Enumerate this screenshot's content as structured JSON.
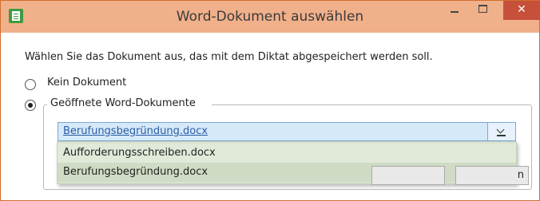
{
  "window": {
    "title": "Word-Dokument auswählen",
    "icon": "word-document-icon",
    "controls": {
      "minimize": "minimize-icon",
      "maximize": "maximize-icon",
      "close": "close-icon"
    },
    "colors": {
      "titlebar": "#f0b08a",
      "close_button": "#c7503a",
      "border": "#d06f2e"
    }
  },
  "content": {
    "instruction": "Wählen Sie das Dokument aus, das mit dem Diktat abgespeichert werden soll.",
    "options": [
      {
        "label": "Kein Dokument",
        "checked": false
      },
      {
        "label": "Geöffnete Word-Dokumente",
        "checked": true
      }
    ],
    "combo": {
      "selected": "Berufungsbegründung.docx",
      "dropdown_icon": "chevron-down-icon",
      "items": [
        "Aufforderungsschreiben.docx",
        "Berufungsbegründung.docx"
      ]
    },
    "buttons": {
      "ok_label": "",
      "cancel_label": "n"
    }
  }
}
